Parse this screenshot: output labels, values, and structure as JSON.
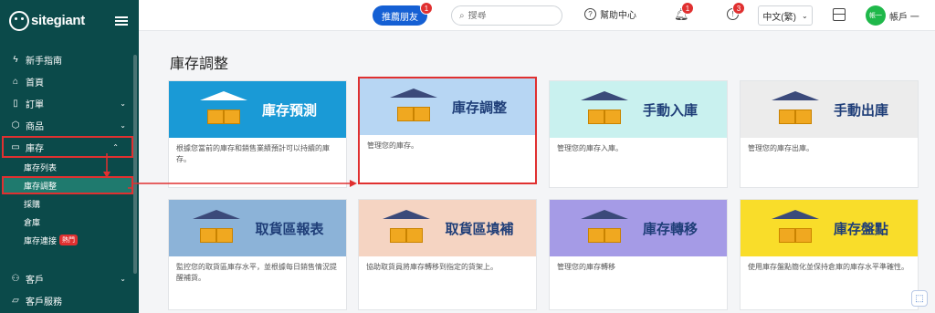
{
  "brand": {
    "name": "sitegiant"
  },
  "sidebar": {
    "items": [
      {
        "icon": "bolt-icon",
        "label": "新手指南"
      },
      {
        "icon": "home-icon",
        "label": "首頁"
      },
      {
        "icon": "clipboard-icon",
        "label": "訂單"
      },
      {
        "icon": "box-icon",
        "label": "商品"
      },
      {
        "icon": "archive-icon",
        "label": "庫存"
      }
    ],
    "inventory_sub": [
      "庫存列表",
      "庫存調整",
      "採購",
      "倉庫",
      "庫存連接"
    ],
    "hot_label": "熱門",
    "bottom_items": [
      {
        "icon": "users-icon",
        "label": "客戶"
      },
      {
        "icon": "chat-icon",
        "label": "客戶服務"
      }
    ]
  },
  "topbar": {
    "refer_label": "推薦朋友",
    "refer_badge": "1",
    "search_placeholder": "搜尋",
    "help_label": "幫助中心",
    "bell_badge": "1",
    "clock_badge": "3",
    "language": "中文(繁)",
    "avatar_initials": "帳一",
    "account_label": "帳戶 一"
  },
  "page": {
    "title": "庫存調整"
  },
  "cards": [
    {
      "name": "庫存預測",
      "desc": "根據您當前的庫存和銷售業績預計可以持續的庫存。",
      "bg": "#1a9ad6",
      "color": "#ffffff"
    },
    {
      "name": "庫存調整",
      "desc": "管理您的庫存。",
      "bg": "#b7d6f3",
      "color": "#1f3e78"
    },
    {
      "name": "手動入庫",
      "desc": "管理您的庫存入庫。",
      "bg": "#c9f1ef",
      "color": "#1f3e78"
    },
    {
      "name": "手動出庫",
      "desc": "管理您的庫存出庫。",
      "bg": "#ececec",
      "color": "#1f3e78"
    },
    {
      "name": "取貨區報表",
      "desc": "監控您的取貨區庫存水平，並根據每日銷售情況提醒補貨。",
      "bg": "#8cb3d8",
      "color": "#1f3e78"
    },
    {
      "name": "取貨區填補",
      "desc": "協助取貨員將庫存轉移到指定的貨架上。",
      "bg": "#f5d4c2",
      "color": "#1f3e78"
    },
    {
      "name": "庫存轉移",
      "desc": "管理您的庫存轉移",
      "bg": "#a59be6",
      "color": "#1f3e78"
    },
    {
      "name": "庫存盤點",
      "desc": "使用庫存盤點簡化並保持倉庫的庫存水平準確性。",
      "bg": "#f9dd2a",
      "color": "#1f3e78"
    }
  ],
  "colors": {
    "sidebar": "#0b4a4a",
    "accent": "#1560d4",
    "highlight": "#e03030"
  }
}
